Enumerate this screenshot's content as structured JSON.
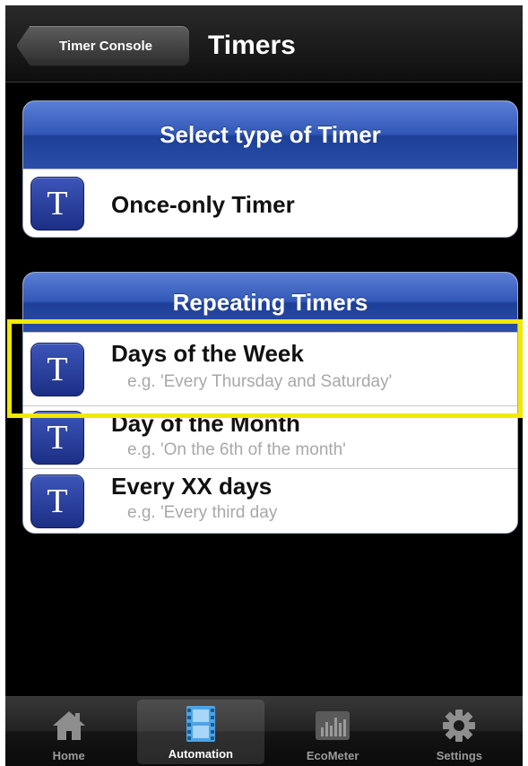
{
  "navbar": {
    "back_label": "Timer Console",
    "title": "Timers"
  },
  "group_once": {
    "header": "Select type of Timer",
    "rows": [
      {
        "icon_letter": "T",
        "title": "Once-only Timer"
      }
    ]
  },
  "group_repeat": {
    "header": "Repeating Timers",
    "rows": [
      {
        "icon_letter": "T",
        "title": "Days of the Week",
        "subtitle": "e.g. 'Every Thursday and Saturday'"
      },
      {
        "icon_letter": "T",
        "title": "Day of the Month",
        "subtitle": "e.g. 'On the 6th of the month'"
      },
      {
        "icon_letter": "T",
        "title": "Every XX days",
        "subtitle": "e.g. 'Every third day"
      }
    ]
  },
  "tabbar": {
    "selected": "Automation",
    "tabs": [
      {
        "label": "Home",
        "icon": "home-icon"
      },
      {
        "label": "Automation",
        "icon": "film-icon"
      },
      {
        "label": "EcoMeter",
        "icon": "bar-chart-icon"
      },
      {
        "label": "Settings",
        "icon": "gear-icon"
      }
    ]
  },
  "colors": {
    "header_blue": "#2a4ea9",
    "highlight": "#f2e800",
    "icon_blue": "#2a3f9e"
  }
}
